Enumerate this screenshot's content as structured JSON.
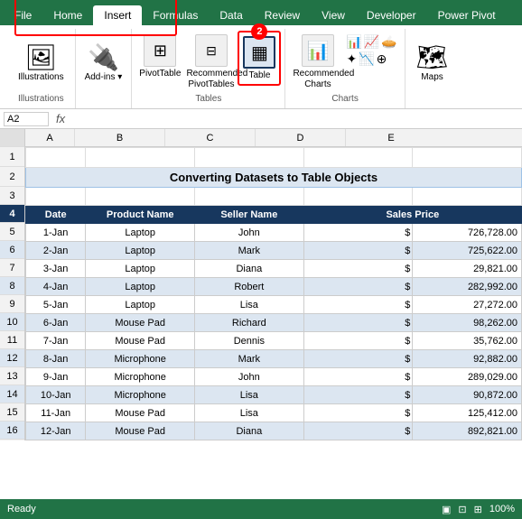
{
  "tabs": {
    "items": [
      "File",
      "Home",
      "Insert",
      "Formulas",
      "Data",
      "Review",
      "View",
      "Developer",
      "Power Pivot"
    ],
    "active": "Insert"
  },
  "ribbon": {
    "groups": [
      {
        "name": "illustrations",
        "label": "Illustrations",
        "buttons": [
          {
            "icon": "🖼",
            "label": "Illustrations"
          }
        ]
      },
      {
        "name": "addins",
        "label": "",
        "buttons": [
          {
            "icon": "⊞",
            "label": "Add-ins ▾"
          }
        ]
      },
      {
        "name": "pivottable",
        "label": "Tables",
        "buttons": [
          {
            "icon": "⊞",
            "label": "PivotTable"
          },
          {
            "icon": "⊟",
            "label": "Recommended PivotTables"
          },
          {
            "icon": "⊞",
            "label": "Table"
          }
        ]
      },
      {
        "name": "charts",
        "label": "Charts",
        "buttons": [
          {
            "icon": "📊",
            "label": "Recommended Charts"
          }
        ]
      },
      {
        "name": "maps",
        "label": "",
        "buttons": [
          {
            "icon": "🗺",
            "label": "Maps"
          }
        ]
      }
    ]
  },
  "formulabar": {
    "namebox": "A2",
    "fx": "fx",
    "formula": ""
  },
  "spreadsheet": {
    "title": "Converting Datasets to Table Objects",
    "col_headers": [
      "",
      "A",
      "B",
      "C",
      "D",
      "E"
    ],
    "headers": [
      "Date",
      "Product Name",
      "Seller Name",
      "Sales Price"
    ],
    "rows": [
      {
        "num": 5,
        "date": "1-Jan",
        "product": "Laptop",
        "seller": "John",
        "price": "$ 726,728.00"
      },
      {
        "num": 6,
        "date": "2-Jan",
        "product": "Laptop",
        "seller": "Mark",
        "price": "$ 725,622.00"
      },
      {
        "num": 7,
        "date": "3-Jan",
        "product": "Laptop",
        "seller": "Diana",
        "price": "$  29,821.00"
      },
      {
        "num": 8,
        "date": "4-Jan",
        "product": "Laptop",
        "seller": "Robert",
        "price": "$ 282,992.00"
      },
      {
        "num": 9,
        "date": "5-Jan",
        "product": "Laptop",
        "seller": "Lisa",
        "price": "$  27,272.00"
      },
      {
        "num": 10,
        "date": "6-Jan",
        "product": "Mouse Pad",
        "seller": "Richard",
        "price": "$  98,262.00"
      },
      {
        "num": 11,
        "date": "7-Jan",
        "product": "Mouse Pad",
        "seller": "Dennis",
        "price": "$  35,762.00"
      },
      {
        "num": 12,
        "date": "8-Jan",
        "product": "Microphone",
        "seller": "Mark",
        "price": "$  92,882.00"
      },
      {
        "num": 13,
        "date": "9-Jan",
        "product": "Microphone",
        "seller": "John",
        "price": "$ 289,029.00"
      },
      {
        "num": 14,
        "date": "10-Jan",
        "product": "Microphone",
        "seller": "Lisa",
        "price": "$  90,872.00"
      },
      {
        "num": 15,
        "date": "11-Jan",
        "product": "Mouse Pad",
        "seller": "Lisa",
        "price": "$ 125,412.00"
      },
      {
        "num": 16,
        "date": "12-Jan",
        "product": "Mouse Pad",
        "seller": "Diana",
        "price": "$ 892,821.00"
      }
    ]
  },
  "labels": {
    "file": "File",
    "home": "Home",
    "insert": "Insert",
    "formulas": "Formulas",
    "data": "Data",
    "review": "Review",
    "view": "View",
    "developer": "Developer",
    "power_pivot": "Power Pivot",
    "illustrations": "Illustrations",
    "add_ins": "Add-ins",
    "pivot_table": "PivotTable",
    "recommended_pivot": "Recommended\nPivotTables",
    "table": "Table",
    "recommended_charts": "Recommended\nCharts",
    "maps": "Maps",
    "tables_group": "Tables",
    "charts_group": "Charts"
  }
}
